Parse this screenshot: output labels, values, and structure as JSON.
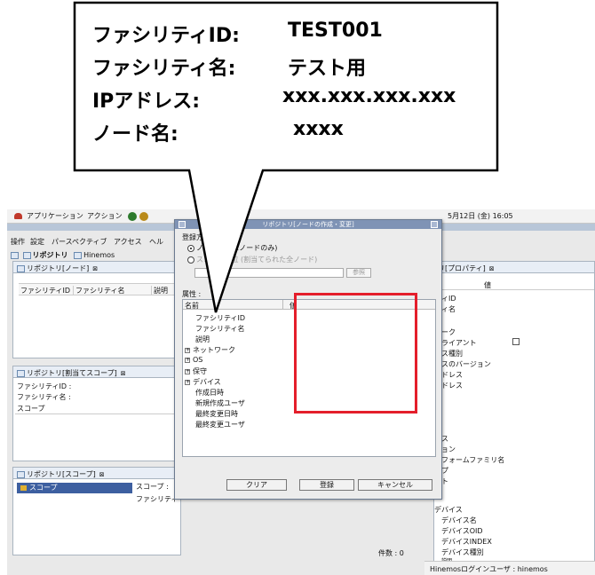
{
  "callout": {
    "facility_id_label": "ファシリティID:",
    "facility_id_value": "TEST001",
    "facility_name_label": "ファシリティ名:",
    "facility_name_value": "テスト用",
    "ip_label": "IPアドレス:",
    "ip_value": "xxx.xxx.xxx.xxx",
    "node_name_label": "ノード名:",
    "node_name_value": "xxxx"
  },
  "topbar": {
    "applications": "アプリケーション",
    "actions": "アクション",
    "clock": "5月12日 (金) 16:05"
  },
  "menubar": [
    "操作",
    "設定",
    "パースペクティブ",
    "アクセス",
    "ヘル"
  ],
  "perspective_tabs": [
    "リポジトリ",
    "Hinemos"
  ],
  "panel_node": {
    "title": "リポジトリ[ノード]",
    "columns": [
      "ファシリティID",
      "ファシリティ名",
      "説明"
    ]
  },
  "panel_assign_scope": {
    "title": "リポジトリ[割当てスコープ]",
    "facility_id": "ファシリティID :",
    "facility_name": "ファシリティ名 :",
    "scope_header": "スコープ"
  },
  "panel_scope": {
    "title": "リポジトリ[スコープ]",
    "selected": "スコープ",
    "scope_label": "スコープ :",
    "facility_label": "ファシリティ"
  },
  "panel_property": {
    "title": "リ[プロパティ]",
    "value_header": "値",
    "rows": [
      "ィID",
      "ィ名",
      "ーク",
      "ライアント",
      "ス種別",
      "スのバージョン",
      "ドレス",
      "ドレス",
      "ス",
      "ョン",
      "フォームファミリ名",
      "プ",
      "ト",
      "デバイス",
      "デバイス名",
      "デバイスOID",
      "デバイスINDEX",
      "デバイス種別",
      "説明"
    ]
  },
  "count_text": "件数 : 0",
  "status_bar": "Hinemosログインユーザ : hinemos",
  "dialog": {
    "title": "リポジトリ[ノードの作成・変更]",
    "reg_method": "登録方法",
    "opt_node": "ノード単位(1ノードのみ)",
    "opt_scope": "スコープ単位 (割当てられた全ノード)",
    "ref_button": "参照",
    "attr_label": "属性 :",
    "col_name": "名前",
    "col_value": "値",
    "rows": [
      "ファシリティID",
      "ファシリティ名",
      "説明",
      "ネットワーク",
      "OS",
      "保守",
      "デバイス",
      "作成日時",
      "新規作成ユーザ",
      "最終変更日時",
      "最終変更ユーザ"
    ],
    "btn_clear": "クリア",
    "btn_register": "登録",
    "btn_cancel": "キャンセル"
  },
  "colors": {
    "highlight": "#e41e2b",
    "selection": "#3d5fa0",
    "titlebar": "#7f93b5"
  }
}
